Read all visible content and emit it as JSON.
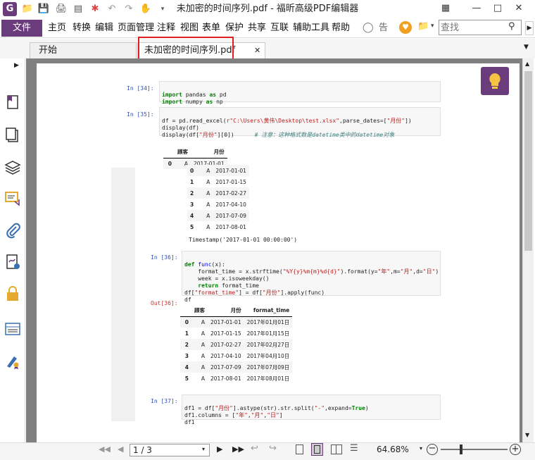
{
  "window": {
    "title": "未加密的时间序列.pdf - 福昕高级PDF编辑器"
  },
  "menu": {
    "file": "文件",
    "items": [
      "主页",
      "转换",
      "编辑",
      "页面管理",
      "注释",
      "视图",
      "表单",
      "保护",
      "共享",
      "互联",
      "辅助工具",
      "帮助"
    ],
    "tell_me": "告诉",
    "search_placeholder": "查找"
  },
  "tabs": [
    {
      "label": "开始"
    },
    {
      "label": "未加密的时间序列.pdf"
    }
  ],
  "doc": {
    "cell34": {
      "prompt": "In  [34]:",
      "lines": [
        "import pandas as pd",
        "import numpy as np"
      ]
    },
    "cell35": {
      "prompt": "In  [35]:",
      "line1_a": "df = pd.read_excel(",
      "line1_str": "r\"C:\\Users\\黄伟\\Desktop\\test.xlsx\"",
      "line1_b": ",parse_dates=[",
      "line1_str2": "\"月份\"",
      "line1_c": "])",
      "line2": "display(df)",
      "line3_a": "display(df[",
      "line3_str": "\"月份\"",
      "line3_b": "][0])",
      "comment": "# 注意：这种格式数是datetime类中的datetime对象"
    },
    "out35_table1": {
      "headers": [
        "",
        "顾客",
        "月份"
      ],
      "rows": [
        [
          "0",
          "A",
          "2017-01-01"
        ]
      ]
    },
    "out35_table2": {
      "rows": [
        [
          "0",
          "A",
          "2017-01-01"
        ],
        [
          "1",
          "A",
          "2017-01-15"
        ],
        [
          "2",
          "A",
          "2017-02-27"
        ],
        [
          "3",
          "A",
          "2017-04-10"
        ],
        [
          "4",
          "A",
          "2017-07-09"
        ],
        [
          "5",
          "A",
          "2017-08-01"
        ]
      ]
    },
    "timestamp": "Timestamp('2017-01-01 00:00:00')",
    "cell36": {
      "prompt": "In  [36]:",
      "out_prompt": "Out[36]:"
    },
    "out36_table": {
      "headers": [
        "",
        "顾客",
        "月份",
        "format_time"
      ],
      "rows": [
        [
          "0",
          "A",
          "2017-01-01",
          "2017年01月01日"
        ],
        [
          "1",
          "A",
          "2017-01-15",
          "2017年01月15日"
        ],
        [
          "2",
          "A",
          "2017-02-27",
          "2017年02月27日"
        ],
        [
          "3",
          "A",
          "2017-04-10",
          "2017年04月10日"
        ],
        [
          "4",
          "A",
          "2017-07-09",
          "2017年07月09日"
        ],
        [
          "5",
          "A",
          "2017-08-01",
          "2017年08月01日"
        ]
      ]
    },
    "cell37": {
      "prompt": "In  [37]:"
    }
  },
  "statusbar": {
    "page": "1 / 3",
    "zoom": "64.68%"
  },
  "colors": {
    "accent": "#6b3c7c",
    "highlight": "#e02020"
  }
}
